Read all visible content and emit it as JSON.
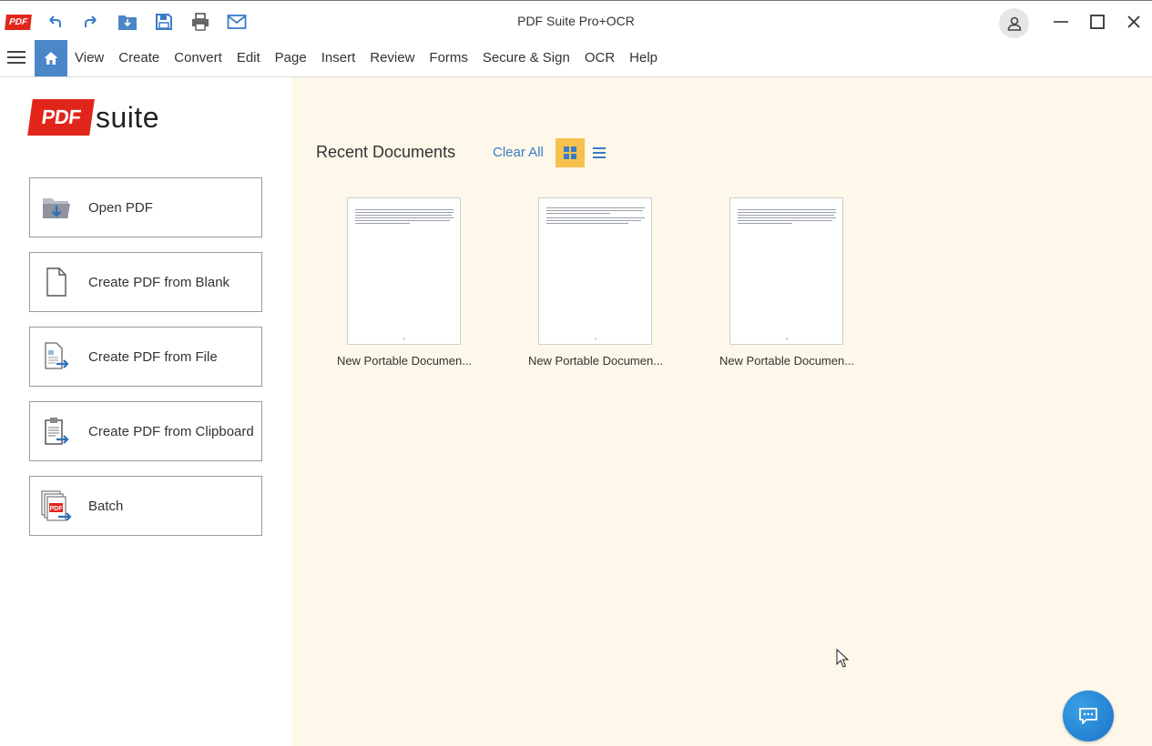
{
  "app": {
    "title": "PDF Suite Pro+OCR",
    "logo_small_text": "PDF"
  },
  "quick_access": [
    "undo-icon",
    "redo-icon",
    "open-folder-icon",
    "save-icon",
    "print-icon",
    "mail-icon"
  ],
  "window_controls": [
    "minimize-icon",
    "maximize-icon",
    "close-icon"
  ],
  "menu": {
    "items": [
      "View",
      "Create",
      "Convert",
      "Edit",
      "Page",
      "Insert",
      "Review",
      "Forms",
      "Secure & Sign",
      "OCR",
      "Help"
    ]
  },
  "brand": {
    "pdf": "PDF",
    "suite": "suite"
  },
  "actions": [
    {
      "label": "Open PDF",
      "icon": "open-folder-icon"
    },
    {
      "label": "Create PDF from Blank",
      "icon": "blank-page-icon"
    },
    {
      "label": "Create PDF from File",
      "icon": "file-convert-icon"
    },
    {
      "label": "Create PDF from Clipboard",
      "icon": "clipboard-icon"
    },
    {
      "label": "Batch",
      "icon": "batch-icon"
    }
  ],
  "recent": {
    "title": "Recent Documents",
    "clear_all": "Clear All",
    "view_mode": "grid",
    "documents": [
      {
        "name": "New Portable Documen..."
      },
      {
        "name": "New Portable Documen..."
      },
      {
        "name": "New Portable Documen..."
      }
    ]
  },
  "colors": {
    "accent_blue": "#4a86c8",
    "brand_red": "#e1251b",
    "panel_bg": "#fdf8e9",
    "active_view": "#f6c14e",
    "link_blue": "#3a7bc8"
  }
}
